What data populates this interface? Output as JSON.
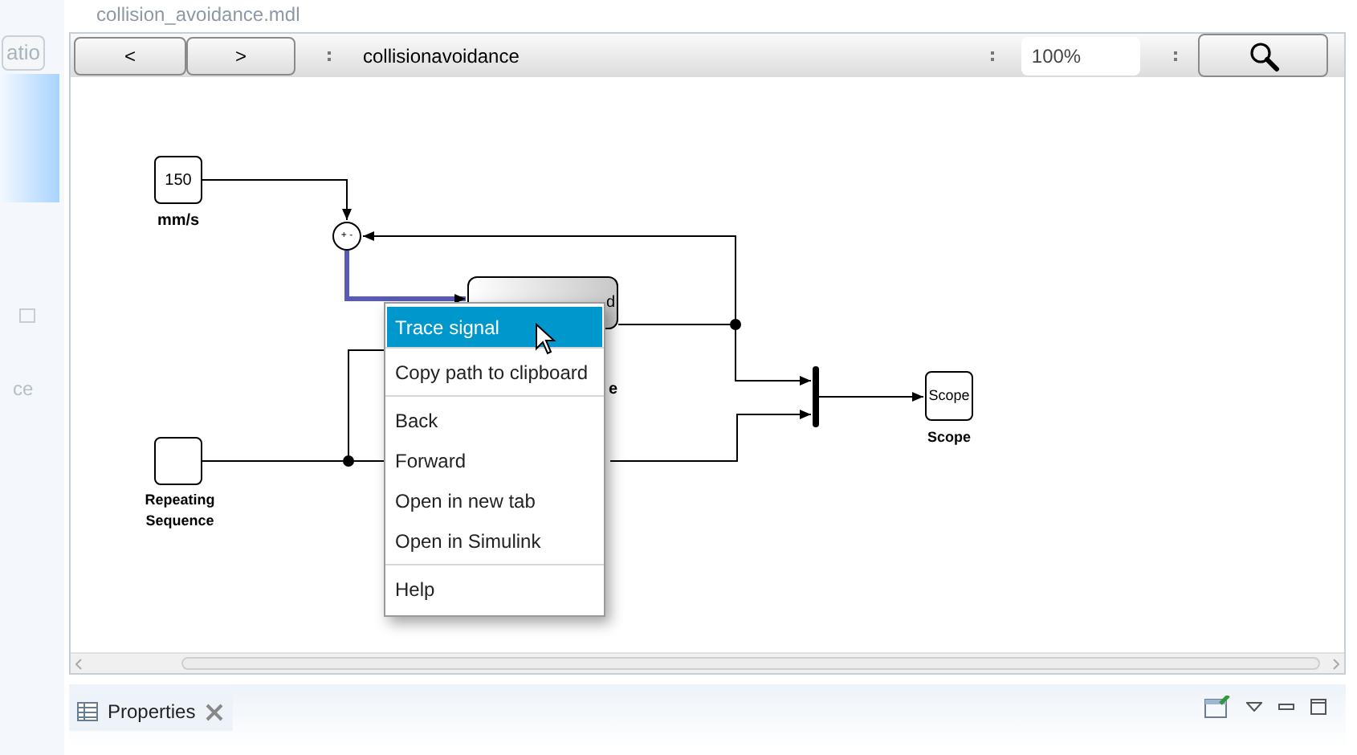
{
  "editor_tab": {
    "title": "collision_avoidance.mdl"
  },
  "left_panel": {
    "button": "atio",
    "text": "ce"
  },
  "toolbar": {
    "back": "<",
    "forward": ">",
    "title": "collisionavoidance",
    "zoom": "100%"
  },
  "diagram": {
    "blocks": [
      {
        "kind": "constant",
        "text": "150",
        "label": "mm/s"
      },
      {
        "kind": "sum",
        "signs": "+ -"
      },
      {
        "kind": "subsystem",
        "port": "d",
        "label": "e"
      },
      {
        "kind": "mux"
      },
      {
        "kind": "scope",
        "text": "Scope",
        "label": "Scope"
      },
      {
        "kind": "source",
        "label": "Repeating Sequence"
      }
    ]
  },
  "context_menu": {
    "groups": [
      [
        {
          "label": "Trace signal",
          "selected": true
        }
      ],
      [
        {
          "label": "Copy path to clipboard",
          "selected": false
        }
      ],
      [
        {
          "label": "Back",
          "selected": false
        },
        {
          "label": "Forward",
          "selected": false
        },
        {
          "label": "Open in new tab",
          "selected": false
        },
        {
          "label": "Open in Simulink",
          "selected": false
        }
      ],
      [
        {
          "label": "Help",
          "selected": false
        }
      ]
    ]
  },
  "properties_tab": {
    "title": "Properties"
  }
}
